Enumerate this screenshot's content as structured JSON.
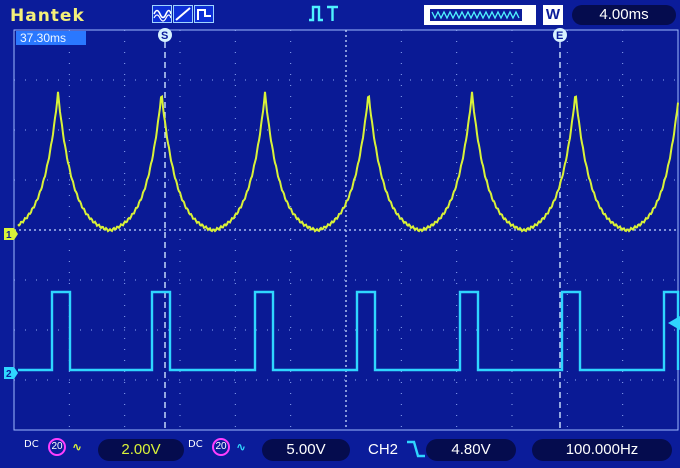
{
  "header": {
    "brand": "Hantek",
    "run_mode_icons": [
      "sine-wave-icon",
      "ramp-icon",
      "pulse-icon"
    ],
    "trigger_icons": [
      "rising-edge-icon",
      "trigger-t-icon"
    ],
    "memory_label": "W",
    "timebase": "4.00ms"
  },
  "screen": {
    "trigger_time": "37.30ms",
    "cursor_s_label": "S",
    "cursor_e_label": "E",
    "ch1_marker": "1",
    "ch2_marker": "2"
  },
  "footer": {
    "ch1": {
      "coupling": "DC",
      "bw": "20",
      "volts": "2.00V"
    },
    "ch2": {
      "coupling": "DC",
      "bw": "20",
      "volts": "5.00V"
    },
    "trigger": {
      "source": "CH2",
      "level": "4.80V"
    },
    "frequency": "100.000Hz"
  },
  "colors": {
    "background": "#0b1c9a",
    "ch1": "#d9f238",
    "ch2": "#2fd6ff",
    "grid": "#9fb9ff",
    "cursor": "#9fd4ff"
  }
}
